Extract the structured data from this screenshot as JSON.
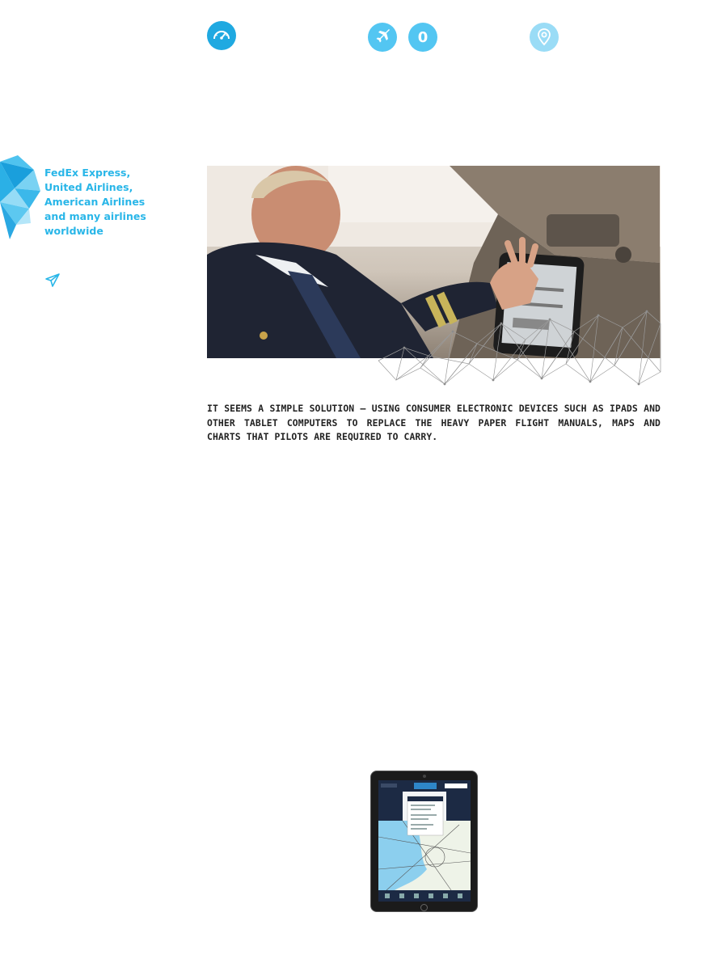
{
  "top_icons": [
    {
      "name": "speedometer-icon"
    },
    {
      "name": "airplane-icon"
    },
    {
      "name": "counter-badge",
      "label": "0"
    },
    {
      "name": "location-pin-icon"
    }
  ],
  "sidebar": {
    "quote": "FedEx Express, United Airlines, American Airlines and many airlines worldwide",
    "icon": "paper-plane-icon"
  },
  "intro_text": "IT SEEMS A SIMPLE SOLUTION – USING CONSUMER ELECTRONIC DEVICES SUCH AS IPADS AND OTHER TABLET COMPUTERS TO REPLACE THE HEAVY PAPER FLIGHT MANUALS, MAPS AND CHARTS THAT PILOTS ARE REQUIRED TO CARRY.",
  "colors": {
    "accent": "#1fa9e1",
    "accent_light": "#53c6f2",
    "accent_pale": "#9adcf6",
    "quote_text": "#29b6e8"
  }
}
